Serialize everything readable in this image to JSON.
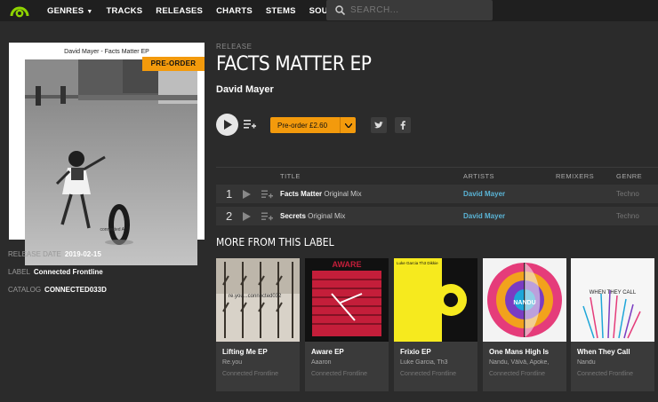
{
  "nav": {
    "items": [
      {
        "label": "GENRES",
        "has_caret": true
      },
      {
        "label": "TRACKS"
      },
      {
        "label": "RELEASES"
      },
      {
        "label": "CHARTS"
      },
      {
        "label": "STEMS"
      },
      {
        "label": "SOUNDS"
      }
    ],
    "search_placeholder": "SEARCH...",
    "caret": "▼"
  },
  "artwork": {
    "title": "David Mayer - Facts Matter EP",
    "badge": "PRE-ORDER",
    "credit": "connected A"
  },
  "meta": {
    "release_date_label": "RELEASE DATE",
    "release_date": "2019-02-15",
    "label_label": "LABEL",
    "label": "Connected Frontline",
    "catalog_label": "CATALOG",
    "catalog": "CONNECTED033D"
  },
  "release": {
    "section_label": "RELEASE",
    "title": "FACTS MATTER EP",
    "artist": "David Mayer",
    "buy_label": "Pre-order £2.60"
  },
  "tracklist": {
    "headers": {
      "title": "TITLE",
      "artists": "ARTISTS",
      "remixers": "REMIXERS",
      "genre": "GENRE"
    },
    "tracks": [
      {
        "num": "1",
        "title": "Facts Matter",
        "mix": "Original Mix",
        "artist": "David Mayer",
        "genre": "Techno"
      },
      {
        "num": "2",
        "title": "Secrets",
        "mix": "Original Mix",
        "artist": "David Mayer",
        "genre": "Techno"
      }
    ]
  },
  "more": {
    "heading": "MORE FROM THIS LABEL",
    "cards": [
      {
        "title": "Lifting Me EP",
        "artist": "Re.you",
        "label": "Connected Frontline",
        "art_text": "re.you...connected032"
      },
      {
        "title": "Aware EP",
        "artist": "Aaaron",
        "label": "Connected Frontline",
        "art_text": "AWARE"
      },
      {
        "title": "Frixio EP",
        "artist": "Luke Garcia, Th3",
        "label": "Connected Frontline",
        "art_text": "Luke Garcia Th3 Dikkie"
      },
      {
        "title": "One Mans High Is",
        "artist": "Nandu, Välvä, Apoke,",
        "label": "Connected Frontline",
        "art_text": "NANDU"
      },
      {
        "title": "When They Call",
        "artist": "Nandu",
        "label": "Connected Frontline",
        "art_text": "WHEN THEY CALL"
      }
    ]
  },
  "colors": {
    "accent": "#f39a0c",
    "artist_link": "#5ab4d6",
    "background": "#2b2b2b"
  }
}
